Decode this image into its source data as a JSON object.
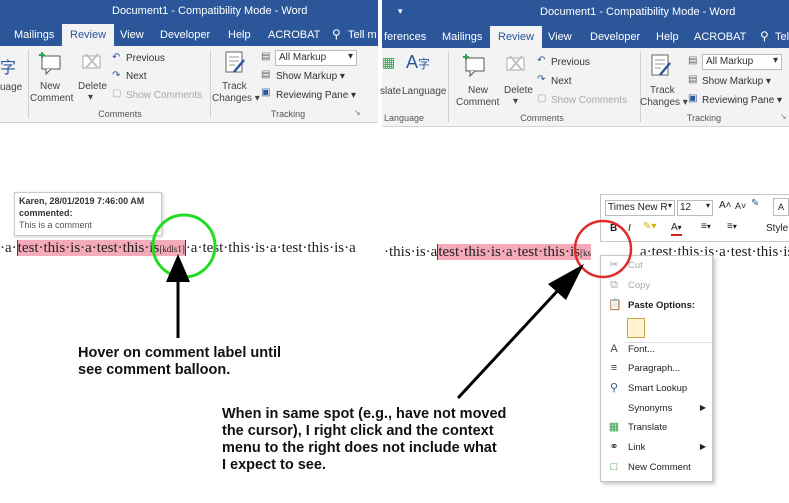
{
  "left": {
    "title": "Document1  -  Compatibility Mode  -  Word",
    "tabs": [
      "Mailings",
      "Review",
      "View",
      "Developer",
      "Help",
      "ACROBAT",
      "Tell m"
    ],
    "active_tab": "Review",
    "lang_glyph": "字",
    "lang_label": "uage",
    "new_comment": [
      "New",
      "Comment"
    ],
    "delete": "Delete",
    "previous": "Previous",
    "next": "Next",
    "show_comments": "Show Comments",
    "track": [
      "Track",
      "Changes ▾"
    ],
    "markup_select": "All Markup",
    "show_markup": "Show Markup ▾",
    "reviewing_pane": "Reviewing Pane ▾",
    "group_comments": "Comments",
    "group_tracking": "Tracking"
  },
  "right": {
    "title": "Document1  -  Compatibility Mode  -  Word",
    "tabs": [
      "ferences",
      "Mailings",
      "Review",
      "View",
      "Developer",
      "Help",
      "ACROBAT",
      "Tell m"
    ],
    "active_tab": "Review",
    "lang_glyph": "字",
    "language": "Language",
    "translate_label": "slate",
    "new_comment": [
      "New",
      "Comment"
    ],
    "delete": "Delete",
    "previous": "Previous",
    "next": "Next",
    "show_comments": "Show Comments",
    "track": [
      "Track",
      "Changes ▾"
    ],
    "markup_select": "All Markup",
    "show_markup": "Show Markup ▾",
    "reviewing_pane": "Reviewing Pane ▾",
    "group_language": "Language",
    "group_comments": "Comments",
    "group_tracking": "Tracking"
  },
  "tooltip": {
    "author_time": "Karen, 28/01/2019 7:46:00 AM",
    "commented": "commented:",
    "text": "This is a comment"
  },
  "doc_left": {
    "pre": "·a·",
    "highlight": "test·this·is·a·test·this·is",
    "comment_tag": "[kdls1]",
    "post": "·a·test·this·is·a·test·this·is·a"
  },
  "doc_right": {
    "pre": "·this·is·a",
    "highlight": "test·this·is·a·test·this·is",
    "comment_tag": "[ks",
    "post": "a·test·this·is·a·test·this·is·"
  },
  "mini_toolbar": {
    "font": "Times New R",
    "size": "12",
    "grow": "A˄",
    "shrink": "A˅",
    "styles": "Style",
    "bold": "B",
    "italic": "I"
  },
  "context_menu": {
    "items": [
      "Cut",
      "Copy",
      "Paste Options:",
      "Font...",
      "Paragraph...",
      "Smart Lookup",
      "Synonyms",
      "Translate",
      "Link",
      "New Comment"
    ]
  },
  "notes": {
    "hover": [
      "Hover on comment label until",
      "see comment balloon."
    ],
    "rightclick": [
      "When in same spot (e.g., have not moved",
      "the cursor), I right click and the context",
      "menu to the right does not include what",
      "I expect to see."
    ]
  },
  "colors": {
    "ribbon_blue": "#2b579a",
    "highlight": "#f4aab9",
    "green_circle": "#22dd22",
    "red_circle": "#e12a2a"
  }
}
